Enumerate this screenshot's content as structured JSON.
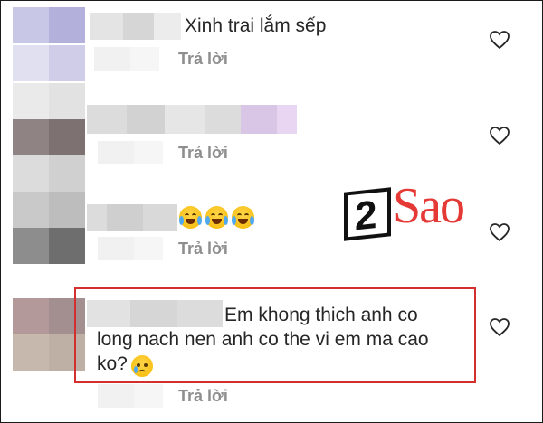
{
  "comments": [
    {
      "text": "Xinh trai lắm sếp",
      "reply_label": "Trả lời",
      "avatar_colors": [
        "#c9c7e6",
        "#b3b1dc",
        "#e1e0f0",
        "#cfcde8"
      ],
      "name_colors": [
        "#e4e4e4",
        "#d6d6d6",
        "#ececec"
      ]
    },
    {
      "text": "",
      "reply_label": "Trả lời",
      "avatar_colors": [
        "#8f8483",
        "#7d7271",
        "#dcdcdc",
        "#d0d0d0"
      ],
      "name_colors": [
        "#dcdcdc",
        "#d2d2d2",
        "#e6e6e6",
        "#dcdcdc",
        "#d9c6e6",
        "#e8d6f2"
      ]
    },
    {
      "text": "",
      "emojis": [
        "face-with-tears-of-joy",
        "face-with-tears-of-joy",
        "face-with-tears-of-joy"
      ],
      "reply_label": "Trả lời",
      "avatar_colors": [
        "#c9c9c9",
        "#bdbdbd",
        "#8d8d8d",
        "#6e6e6e"
      ],
      "name_colors": [
        "#dcdcdc",
        "#cfcfcf",
        "#d9d9d9"
      ]
    },
    {
      "text_line1": "Em khong thich anh co",
      "text_line2": "long nach nen anh co the vi em ma cao",
      "text_line3": "ko?",
      "emoji": "crying-face",
      "reply_label": "Trả lời",
      "avatar_colors": [
        "#b39999",
        "#a38f8f",
        "#c6b8ad",
        "#bfb0a6"
      ],
      "name_colors": [
        "#e2e2e2",
        "#d6d6d6",
        "#dcdcdc"
      ]
    }
  ],
  "watermark": {
    "number": "2",
    "text": "Sao"
  },
  "colors": {
    "highlight_border": "#d32f2f",
    "text": "#262626",
    "muted": "#8e8e8e",
    "watermark_red": "#e53935"
  },
  "icons": {
    "like": "heart-outline-icon"
  }
}
